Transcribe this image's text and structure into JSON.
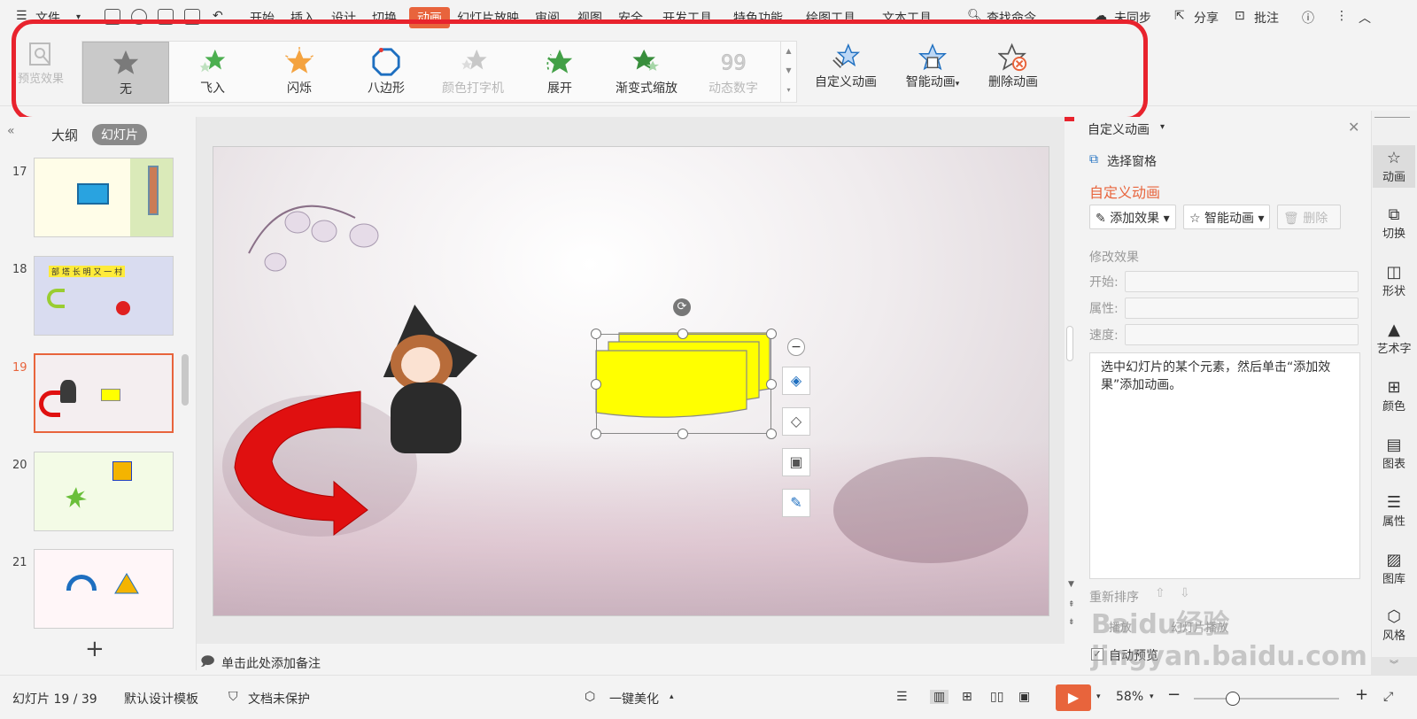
{
  "menu": {
    "file": "文件",
    "tabs": [
      "开始",
      "插入",
      "设计",
      "切换",
      "动画",
      "幻灯片放映",
      "审阅",
      "视图",
      "安全",
      "开发工具",
      "特色功能",
      "绘图工具",
      "文本工具"
    ],
    "active_tab": "动画",
    "search": "查找命令",
    "sync": "未同步",
    "share": "分享",
    "comment": "批注"
  },
  "ribbon": {
    "preview": "预览效果",
    "gallery": [
      {
        "label": "无",
        "icon": "star-gray-icon",
        "selected": true,
        "disabled": false
      },
      {
        "label": "飞入",
        "icon": "star-fly-icon",
        "selected": false,
        "disabled": false
      },
      {
        "label": "闪烁",
        "icon": "star-flash-icon",
        "selected": false,
        "disabled": false
      },
      {
        "label": "八边形",
        "icon": "octagon-icon",
        "selected": false,
        "disabled": false
      },
      {
        "label": "颜色打字机",
        "icon": "star-typewriter-icon",
        "selected": false,
        "disabled": true
      },
      {
        "label": "展开",
        "icon": "star-expand-icon",
        "selected": false,
        "disabled": false
      },
      {
        "label": "渐变式缩放",
        "icon": "star-zoom-icon",
        "selected": false,
        "disabled": false
      },
      {
        "label": "动态数字",
        "icon": "number-99-icon",
        "selected": false,
        "disabled": true
      }
    ],
    "custom_anim": "自定义动画",
    "smart_anim": "智能动画",
    "delete_anim": "删除动画"
  },
  "left_panel": {
    "outline_tab": "大纲",
    "slides_tab": "幻灯片",
    "slides": [
      {
        "num": "17"
      },
      {
        "num": "18"
      },
      {
        "num": "19"
      },
      {
        "num": "20"
      },
      {
        "num": "21"
      }
    ],
    "selected_slide": "19",
    "thumb18_text": "部 塔 长 明 又 一 村"
  },
  "notes_placeholder": "单击此处添加备注",
  "right_panel": {
    "title": "自定义动画",
    "select_pane": "选择窗格",
    "section_title": "自定义动画",
    "add_effect": "添加效果",
    "smart_anim": "智能动画",
    "delete": "删除",
    "modify_effect": "修改效果",
    "start_label": "开始:",
    "property_label": "属性:",
    "speed_label": "速度:",
    "hint": "选中幻灯片的某个元素，然后单击“添加效果”添加动画。",
    "reorder": "重新排序",
    "play": "播放",
    "slideshow": "幻灯片播放",
    "auto_preview": "自动预览"
  },
  "rail": [
    "动画",
    "切换",
    "形状",
    "艺术字",
    "颜色",
    "图表",
    "属性",
    "图库",
    "风格"
  ],
  "statusbar": {
    "slide_info": "幻灯片 19 / 39",
    "template": "默认设计模板",
    "protect": "文档未保护",
    "beautify": "一键美化",
    "zoom": "58%"
  },
  "watermark": "Baidu经验 jingyan.baidu.com",
  "colors": {
    "accent": "#e8643c",
    "highlight": "#e8232d",
    "slide_shape_fill": "#ffff00",
    "arrow_red": "#e01010"
  }
}
